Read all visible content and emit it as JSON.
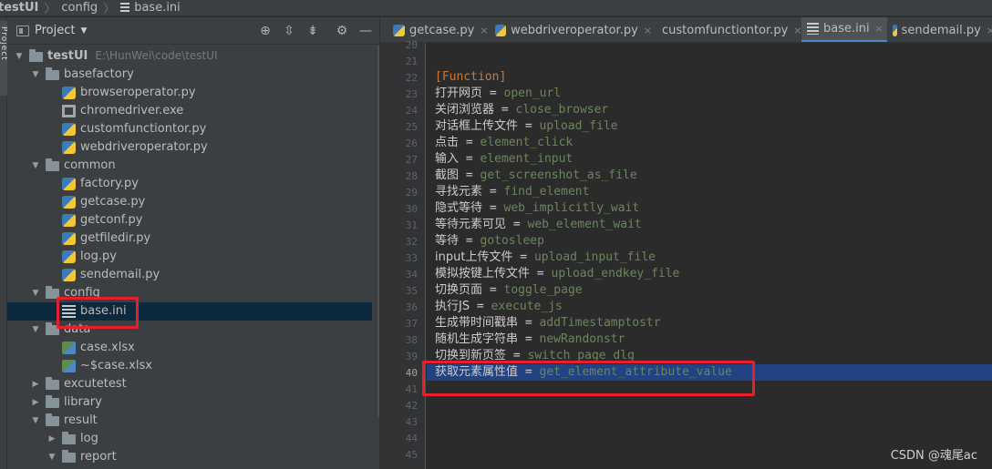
{
  "breadcrumb": {
    "root": "testUI",
    "folder": "config",
    "file": "base.ini"
  },
  "side_strip": {
    "label": "Project"
  },
  "panel": {
    "title": "Project"
  },
  "tree": [
    {
      "label": "testUI",
      "path": "E:\\HunWei\\code\\testUI",
      "type": "folder",
      "expanded": true
    },
    {
      "label": "basefactory",
      "type": "folder",
      "expanded": true
    },
    {
      "label": "browseroperator.py",
      "type": "py"
    },
    {
      "label": "chromedriver.exe",
      "type": "exe"
    },
    {
      "label": "customfunctiontor.py",
      "type": "py"
    },
    {
      "label": "webdriveroperator.py",
      "type": "py"
    },
    {
      "label": "common",
      "type": "folder",
      "expanded": true
    },
    {
      "label": "factory.py",
      "type": "py"
    },
    {
      "label": "getcase.py",
      "type": "py"
    },
    {
      "label": "getconf.py",
      "type": "py"
    },
    {
      "label": "getfiledir.py",
      "type": "py"
    },
    {
      "label": "log.py",
      "type": "py"
    },
    {
      "label": "sendemail.py",
      "type": "py"
    },
    {
      "label": "config",
      "type": "folder",
      "expanded": true
    },
    {
      "label": "base.ini",
      "type": "ini",
      "selected": true
    },
    {
      "label": "data",
      "type": "folder",
      "expanded": true
    },
    {
      "label": "case.xlsx",
      "type": "xlsx"
    },
    {
      "label": "~$case.xlsx",
      "type": "xlsx"
    },
    {
      "label": "excutetest",
      "type": "folder",
      "expanded": false
    },
    {
      "label": "library",
      "type": "folder",
      "expanded": false
    },
    {
      "label": "result",
      "type": "folder",
      "expanded": true
    },
    {
      "label": "log",
      "type": "folder",
      "expanded": false
    },
    {
      "label": "report",
      "type": "folder",
      "expanded": true
    }
  ],
  "tabs": [
    {
      "label": "getcase.py",
      "type": "py"
    },
    {
      "label": "webdriveroperator.py",
      "type": "py"
    },
    {
      "label": "customfunctiontor.py",
      "type": "py"
    },
    {
      "label": "base.ini",
      "type": "ini",
      "active": true
    },
    {
      "label": "sendemail.py",
      "type": "py"
    }
  ],
  "line_numbers": [
    "20",
    "21",
    "22",
    "23",
    "24",
    "25",
    "26",
    "27",
    "28",
    "29",
    "30",
    "31",
    "32",
    "33",
    "34",
    "35",
    "36",
    "37",
    "38",
    "39",
    "40",
    "41",
    "42",
    "43",
    "44",
    "45"
  ],
  "current_line": "40",
  "code": {
    "section": "[Function]",
    "entries": [
      {
        "key": "打开网页",
        "value": "open_url"
      },
      {
        "key": "关闭浏览器",
        "value": "close_browser"
      },
      {
        "key": "对话框上传文件",
        "value": "upload_file"
      },
      {
        "key": "点击",
        "value": "element_click"
      },
      {
        "key": "输入",
        "value": "element_input"
      },
      {
        "key": "截图",
        "value": "get_screenshot_as_file"
      },
      {
        "key": "寻找元素",
        "value": "find_element"
      },
      {
        "key": "隐式等待",
        "value": "web_implicitly_wait"
      },
      {
        "key": "等待元素可见",
        "value": "web_element_wait"
      },
      {
        "key": "等待",
        "value": "gotosleep"
      },
      {
        "key": "input上传文件",
        "value": "upload_input_file"
      },
      {
        "key": "模拟按键上传文件",
        "value": "upload_endkey_file"
      },
      {
        "key": "切换页面",
        "value": "toggle_page"
      },
      {
        "key": "执行JS",
        "value": "execute_js"
      },
      {
        "key": "生成带时间戳串",
        "value": "addTimestamptostr"
      },
      {
        "key": "随机生成字符串",
        "value": "newRandonstr"
      },
      {
        "key": "切换到新页签",
        "value": "switch_page_dlg"
      },
      {
        "key": "获取元素属性值",
        "value": "get_element_attribute_value"
      }
    ]
  },
  "colors": {
    "highlight": "#e5202a",
    "selection": "#214283",
    "string": "#6a8759",
    "section": "#cc7832"
  },
  "watermark": "CSDN @魂尾ac"
}
